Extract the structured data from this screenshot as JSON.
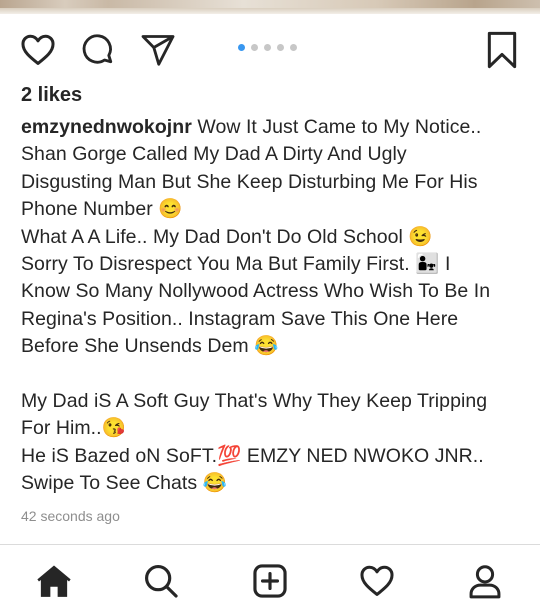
{
  "post": {
    "likes": "2 likes",
    "username": "emzynednwokojnr",
    "caption_lines": [
      " Wow It Just Came to My Notice..",
      "Shan Gorge Called My Dad A Dirty And Ugly",
      "Disgusting Man But She Keep Disturbing Me For His",
      "Phone Number 😊",
      "What A A Life.. My Dad Don't Do Old School 😉",
      "Sorry To Disrespect You Ma But Family First. 👨‍👧 I",
      "Know So Many Nollywood Actress Who Wish To Be In",
      "Regina's Position.. Instagram Save This One Here",
      "Before She Unsends Dem 😂",
      "My Dad iS A Soft Guy That's Why They Keep Tripping",
      "For Him..😘",
      "He iS Bazed oN SoFT.💯 EMZY NED NWOKO JNR..",
      "Swipe To See Chats 😂"
    ],
    "timestamp": "42 seconds ago"
  },
  "carousel": {
    "total": 5,
    "active": 0
  },
  "icons": {
    "actions": [
      "heart-icon",
      "comment-icon",
      "share-icon",
      "bookmark-icon"
    ],
    "nav": [
      "home-icon",
      "search-icon",
      "add-post-icon",
      "activity-heart-icon",
      "profile-icon"
    ]
  },
  "colors": {
    "accent": "#3897f0",
    "text": "#262626",
    "muted": "#8e8e8e"
  }
}
